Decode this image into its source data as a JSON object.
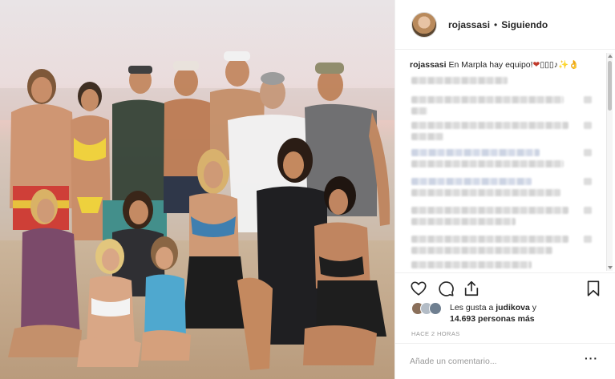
{
  "post": {
    "username": "rojassasi",
    "separator": "•",
    "follow_status": "Siguiendo",
    "caption_user": "rojassasi",
    "caption_text": "En Marpla hay equipo!",
    "caption_emoji_heart": "❤",
    "caption_emoji_rest": "▯▯▯♪",
    "caption_emoji_tail": "✨👌"
  },
  "likes": {
    "prefix": "Les gusta a",
    "user": "judikova",
    "suffix": "y",
    "count_line": "14.693 personas más"
  },
  "timestamp": "HACE 2 HORAS",
  "comment": {
    "placeholder": "Añade un comentario...",
    "more": "···"
  },
  "icons": [
    "heart-icon",
    "comment-icon",
    "share-icon",
    "bookmark-icon",
    "more-options-icon"
  ],
  "colors": {
    "heart": "#c0392b",
    "text": "#262626",
    "muted": "#999999",
    "border": "#efefef"
  }
}
